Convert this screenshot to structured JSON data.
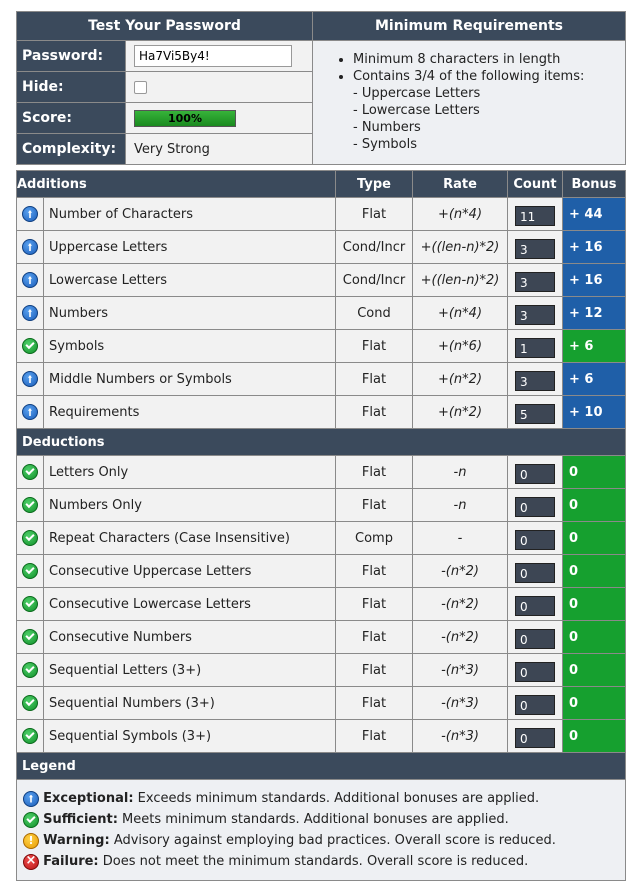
{
  "top": {
    "left_header": "Test Your Password",
    "right_header": "Minimum Requirements",
    "password_label": "Password:",
    "password_value": "Ha7Vi5By4!",
    "hide_label": "Hide:",
    "score_label": "Score:",
    "score_text": "100%",
    "score_fraction": 1.0,
    "complexity_label": "Complexity:",
    "complexity_value": "Very Strong",
    "requirements": [
      "Minimum 8 characters in length",
      "Contains 3/4 of the following items:"
    ],
    "sub_requirements": [
      "- Uppercase Letters",
      "- Lowercase Letters",
      "- Numbers",
      "- Symbols"
    ]
  },
  "table": {
    "headers": {
      "name": "Additions",
      "type": "Type",
      "rate": "Rate",
      "count": "Count",
      "bonus": "Bonus"
    },
    "deductions_label": "Deductions",
    "additions": [
      {
        "icon": "exceptional-icon",
        "name": "Number of Characters",
        "type": "Flat",
        "rate": "+(n*4)",
        "count": "11",
        "bonus": "+ 44",
        "color": "#1f5fa8"
      },
      {
        "icon": "exceptional-icon",
        "name": "Uppercase Letters",
        "type": "Cond/Incr",
        "rate": "+((len-n)*2)",
        "count": "3",
        "bonus": "+ 16",
        "color": "#1f5fa8"
      },
      {
        "icon": "exceptional-icon",
        "name": "Lowercase Letters",
        "type": "Cond/Incr",
        "rate": "+((len-n)*2)",
        "count": "3",
        "bonus": "+ 16",
        "color": "#1f5fa8"
      },
      {
        "icon": "exceptional-icon",
        "name": "Numbers",
        "type": "Cond",
        "rate": "+(n*4)",
        "count": "3",
        "bonus": "+ 12",
        "color": "#1f5fa8"
      },
      {
        "icon": "sufficient-icon",
        "name": "Symbols",
        "type": "Flat",
        "rate": "+(n*6)",
        "count": "1",
        "bonus": "+ 6",
        "color": "#16a02f"
      },
      {
        "icon": "exceptional-icon",
        "name": "Middle Numbers or Symbols",
        "type": "Flat",
        "rate": "+(n*2)",
        "count": "3",
        "bonus": "+ 6",
        "color": "#1f5fa8"
      },
      {
        "icon": "exceptional-icon",
        "name": "Requirements",
        "type": "Flat",
        "rate": "+(n*2)",
        "count": "5",
        "bonus": "+ 10",
        "color": "#1f5fa8"
      }
    ],
    "deductions": [
      {
        "icon": "sufficient-icon",
        "name": "Letters Only",
        "type": "Flat",
        "rate": "-n",
        "count": "0",
        "bonus": "0",
        "color": "#16a02f"
      },
      {
        "icon": "sufficient-icon",
        "name": "Numbers Only",
        "type": "Flat",
        "rate": "-n",
        "count": "0",
        "bonus": "0",
        "color": "#16a02f"
      },
      {
        "icon": "sufficient-icon",
        "name": "Repeat Characters (Case Insensitive)",
        "type": "Comp",
        "rate": "-",
        "count": "0",
        "bonus": "0",
        "color": "#16a02f"
      },
      {
        "icon": "sufficient-icon",
        "name": "Consecutive Uppercase Letters",
        "type": "Flat",
        "rate": "-(n*2)",
        "count": "0",
        "bonus": "0",
        "color": "#16a02f"
      },
      {
        "icon": "sufficient-icon",
        "name": "Consecutive Lowercase Letters",
        "type": "Flat",
        "rate": "-(n*2)",
        "count": "0",
        "bonus": "0",
        "color": "#16a02f"
      },
      {
        "icon": "sufficient-icon",
        "name": "Consecutive Numbers",
        "type": "Flat",
        "rate": "-(n*2)",
        "count": "0",
        "bonus": "0",
        "color": "#16a02f"
      },
      {
        "icon": "sufficient-icon",
        "name": "Sequential Letters (3+)",
        "type": "Flat",
        "rate": "-(n*3)",
        "count": "0",
        "bonus": "0",
        "color": "#16a02f"
      },
      {
        "icon": "sufficient-icon",
        "name": "Sequential Numbers (3+)",
        "type": "Flat",
        "rate": "-(n*3)",
        "count": "0",
        "bonus": "0",
        "color": "#16a02f"
      },
      {
        "icon": "sufficient-icon",
        "name": "Sequential Symbols (3+)",
        "type": "Flat",
        "rate": "-(n*3)",
        "count": "0",
        "bonus": "0",
        "color": "#16a02f"
      }
    ]
  },
  "legend": {
    "title": "Legend",
    "items": [
      {
        "icon": "exceptional-icon",
        "term": "Exceptional:",
        "desc": "Exceeds minimum standards. Additional bonuses are applied."
      },
      {
        "icon": "sufficient-icon",
        "term": "Sufficient:",
        "desc": "Meets minimum standards. Additional bonuses are applied."
      },
      {
        "icon": "warning-icon",
        "term": "Warning:",
        "desc": "Advisory against employing bad practices. Overall score is reduced."
      },
      {
        "icon": "failure-icon",
        "term": "Failure:",
        "desc": "Does not meet the minimum standards. Overall score is reduced."
      }
    ]
  }
}
